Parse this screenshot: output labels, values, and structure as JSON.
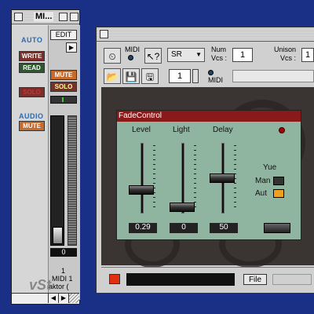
{
  "mixer": {
    "title": "MI...",
    "edit_label": "EDIT",
    "auto_label": "AUTO",
    "write_label": "WRITE",
    "read_label": "READ",
    "solo_left_label": "SOLO",
    "audio_label": "AUDIO",
    "mute_left_label": "MUTE",
    "mute_right_label": "MUTE",
    "solo_right_label": "SOLO",
    "fader_value": "0",
    "channel_number": "1",
    "channel_name": "MIDI 1",
    "channel_device": "aktor (",
    "logo_text": "vSt"
  },
  "main": {
    "midi_label": "MIDI",
    "midi_label2": "MIDI",
    "sr_value": "SR",
    "num_voices_label_1": "Num",
    "num_voices_label_2": "Vcs :",
    "num_voices_value": "1",
    "unison_label": "Unison",
    "unison_vcs_label": "Vcs :",
    "unison_value": "1",
    "field_value": "1",
    "file_label": "File"
  },
  "fade_control": {
    "title": "FadeControl",
    "level_label": "Level",
    "light_label": "Light",
    "delay_label": "Delay",
    "level_value": "0.29",
    "light_value": "0",
    "delay_value": "50",
    "yue_label": "Yue",
    "man_label": "Man",
    "aut_label": "Aut"
  },
  "colors": {
    "desktop": "#1a2f86",
    "fade_head": "#8a1a1a",
    "fade_bg": "#8fb5a0",
    "aut_toggle": "#f0a020",
    "record_indicator": "#e03010"
  }
}
